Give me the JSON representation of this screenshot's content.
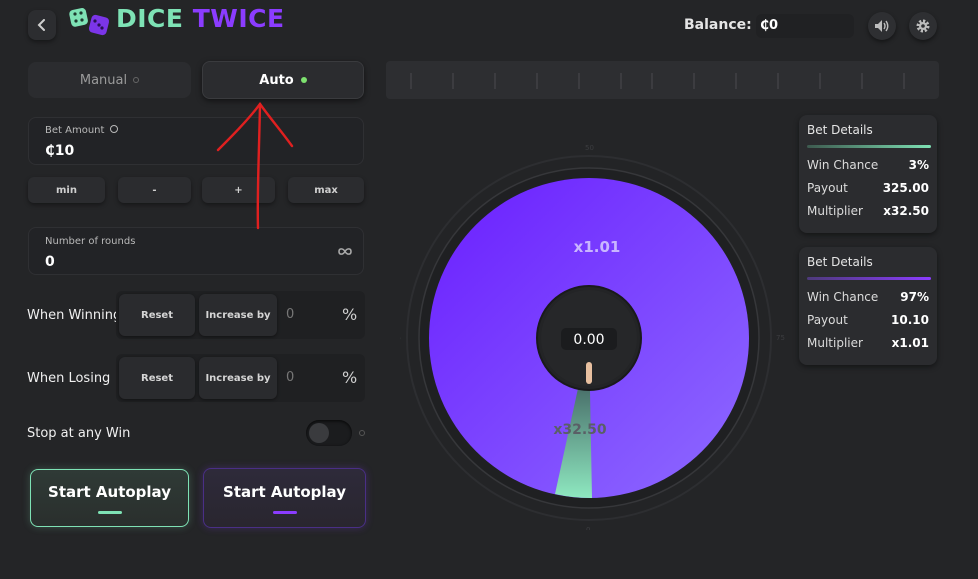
{
  "header": {
    "back_icon": "chevron-left-icon",
    "logo_part1": "DICE",
    "logo_part2": "TWICE",
    "balance_label": "Balance:",
    "balance_value": "₵0",
    "sound_icon": "speaker-icon",
    "settings_icon": "gear-icon"
  },
  "modes": {
    "manual": "Manual",
    "auto": "Auto",
    "active": "Auto"
  },
  "bet_amount": {
    "label": "Bet Amount",
    "value": "₵10",
    "info_icon": "info-icon"
  },
  "bet_buttons": {
    "min": "min",
    "minus": "-",
    "plus": "+",
    "max": "max"
  },
  "rounds": {
    "label": "Number of rounds",
    "value": "0",
    "infinity_icon": "infinity-icon"
  },
  "when_winning": {
    "label": "When Winning",
    "reset": "Reset",
    "increase": "Increase by",
    "value": "0",
    "unit": "%"
  },
  "when_losing": {
    "label": "When Losing",
    "reset": "Reset",
    "increase": "Increase by",
    "value": "0",
    "unit": "%"
  },
  "stop_on_win": {
    "label": "Stop at any Win",
    "enabled": false
  },
  "autoplay": {
    "left_label": "Start Autoplay",
    "right_label": "Start Autoplay"
  },
  "wheel": {
    "result": "0.00",
    "big_label": "x1.01",
    "small_label": "x32.50",
    "tick_top": "50",
    "tick_left": "25",
    "tick_right": "75",
    "tick_bottom": "0"
  },
  "details_green": {
    "title": "Bet Details",
    "win_chance_label": "Win Chance",
    "win_chance": "3%",
    "payout_label": "Payout",
    "payout": "325.00",
    "multiplier_label": "Multiplier",
    "multiplier": "x32.50"
  },
  "details_purple": {
    "title": "Bet Details",
    "win_chance_label": "Win Chance",
    "win_chance": "97%",
    "payout_label": "Payout",
    "payout": "10.10",
    "multiplier_label": "Multiplier",
    "multiplier": "x1.01"
  },
  "colors": {
    "accent_green": "#7ee2b5",
    "accent_purple": "#8b3cff",
    "annotation_red": "#e02020"
  }
}
